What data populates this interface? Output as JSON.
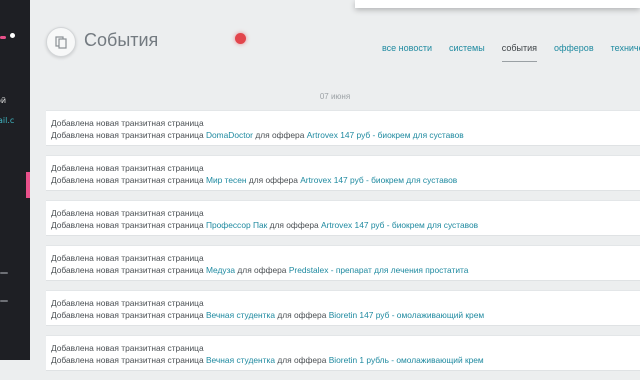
{
  "sidebar": {
    "text1": "ой",
    "text2": "ail.c"
  },
  "header": {
    "title": "События",
    "tabs": [
      {
        "label": "все новости",
        "active": false
      },
      {
        "label": "системы",
        "active": false
      },
      {
        "label": "события",
        "active": true
      },
      {
        "label": "офферов",
        "active": false
      },
      {
        "label": "техническ",
        "active": false
      }
    ]
  },
  "date_separator": "07 июня",
  "events": [
    {
      "title": "Добавлена новая транзитная страница",
      "prefix": "Добавлена новая транзитная страница",
      "page": "DomaDoctor",
      "mid": "для оффера",
      "offer": "Artrovex 147 руб - биокрем для суставов"
    },
    {
      "title": "Добавлена новая транзитная страница",
      "prefix": "Добавлена новая транзитная страница",
      "page": "Мир тесен",
      "mid": "для оффера",
      "offer": "Artrovex 147 руб - биокрем для суставов"
    },
    {
      "title": "Добавлена новая транзитная страница",
      "prefix": "Добавлена новая транзитная страница",
      "page": "Профессор Пак",
      "mid": "для оффера",
      "offer": "Artrovex 147 руб - биокрем для суставов"
    },
    {
      "title": "Добавлена новая транзитная страница",
      "prefix": "Добавлена новая транзитная страница",
      "page": "Медуза",
      "mid": "для оффера",
      "offer": "Predstalex - препарат для лечения простатита"
    },
    {
      "title": "Добавлена новая транзитная страница",
      "prefix": "Добавлена новая транзитная страница",
      "page": "Вечная студентка",
      "mid": "для оффера",
      "offer": "Bioretin 147 руб - омолаживающий крем"
    },
    {
      "title": "Добавлена новая транзитная страница",
      "prefix": "Добавлена новая транзитная страница",
      "page": "Вечная студентка",
      "mid": "для оффера",
      "offer": "Bioretin 1 рубль - омолаживающий крем"
    }
  ],
  "icons": {
    "page_icon": "copy-icon"
  },
  "colors": {
    "link": "#1f8aa0",
    "accent": "#e8508a",
    "cursor": "#e2454c"
  }
}
